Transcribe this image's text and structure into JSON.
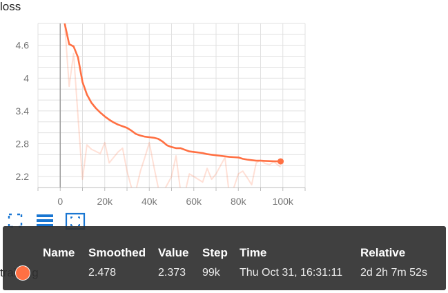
{
  "card": {
    "title": "loss"
  },
  "chart_data": {
    "type": "line",
    "title": "loss",
    "xlabel": "",
    "ylabel": "",
    "xlim": [
      -10000,
      110000
    ],
    "ylim": [
      2.0,
      5.0
    ],
    "xticks": [
      0,
      20000,
      40000,
      60000,
      80000,
      100000
    ],
    "xtick_labels": [
      "0",
      "20k",
      "40k",
      "60k",
      "80k",
      "100k"
    ],
    "yticks": [
      2.2,
      2.8,
      3.4,
      4,
      4.6
    ],
    "ytick_labels": [
      "2.2",
      "2.8",
      "3.4",
      "4",
      "4.6"
    ],
    "grid": true,
    "series": [
      {
        "role": "raw",
        "color": "#ff7043",
        "opacity": 0.22,
        "x": [
          2000,
          4000,
          6000,
          8000,
          10000,
          12000,
          14000,
          16000,
          18000,
          20000,
          22000,
          24000,
          26000,
          28000,
          30000,
          32000,
          34000,
          36000,
          38000,
          40000,
          42000,
          44000,
          46000,
          48000,
          50000,
          52000,
          54000,
          56000,
          58000,
          60000,
          62000,
          64000,
          66000,
          68000,
          70000,
          72000,
          74000,
          76000,
          78000,
          80000,
          82000,
          84000,
          86000,
          88000,
          90000,
          92000,
          94000,
          96000,
          99000
        ],
        "y": [
          5.0,
          3.85,
          4.45,
          3.3,
          2.15,
          2.78,
          2.7,
          2.66,
          2.62,
          2.82,
          2.45,
          2.55,
          2.65,
          2.72,
          2.3,
          2.0,
          1.95,
          2.3,
          2.55,
          2.82,
          2.4,
          2.0,
          1.9,
          2.05,
          2.2,
          2.58,
          1.95,
          1.9,
          2.25,
          2.2,
          2.15,
          2.1,
          2.35,
          2.15,
          2.25,
          2.4,
          2.55,
          1.85,
          2.0,
          2.25,
          2.3,
          2.18,
          2.05,
          2.45,
          2.5,
          2.44,
          2.42,
          2.47,
          2.373
        ]
      },
      {
        "role": "smoothed",
        "color": "#ff7043",
        "opacity": 1,
        "x": [
          2000,
          4000,
          6000,
          8000,
          10000,
          12000,
          14000,
          16000,
          18000,
          20000,
          22000,
          24000,
          26000,
          28000,
          30000,
          32000,
          34000,
          36000,
          38000,
          40000,
          42000,
          44000,
          46000,
          48000,
          50000,
          52000,
          54000,
          56000,
          58000,
          60000,
          62000,
          64000,
          66000,
          68000,
          70000,
          72000,
          74000,
          76000,
          78000,
          80000,
          82000,
          84000,
          86000,
          88000,
          90000,
          92000,
          94000,
          96000,
          99000
        ],
        "y": [
          5.0,
          4.62,
          4.58,
          4.38,
          3.93,
          3.7,
          3.55,
          3.45,
          3.37,
          3.3,
          3.24,
          3.19,
          3.15,
          3.12,
          3.09,
          3.04,
          2.98,
          2.95,
          2.93,
          2.92,
          2.91,
          2.89,
          2.84,
          2.77,
          2.74,
          2.72,
          2.72,
          2.69,
          2.66,
          2.65,
          2.64,
          2.63,
          2.61,
          2.6,
          2.59,
          2.58,
          2.57,
          2.56,
          2.555,
          2.55,
          2.525,
          2.51,
          2.5,
          2.49,
          2.49,
          2.487,
          2.483,
          2.48,
          2.478
        ]
      }
    ],
    "highlight": {
      "x": 99000,
      "y": 2.478
    }
  },
  "controls": {
    "expand_icon": "fullscreen-icon",
    "data_icon": "list-icon",
    "fit_icon": "fit-domain-icon"
  },
  "run_label_partial": "training",
  "tooltip": {
    "columns": [
      "Name",
      "Smoothed",
      "Value",
      "Step",
      "Time",
      "Relative"
    ],
    "row": {
      "swatch_color": "#ff7043",
      "name": "",
      "smoothed": "2.478",
      "value": "2.373",
      "step": "99k",
      "time": "Thu Oct 31, 16:31:11",
      "relative": "2d 2h 7m 52s"
    }
  }
}
